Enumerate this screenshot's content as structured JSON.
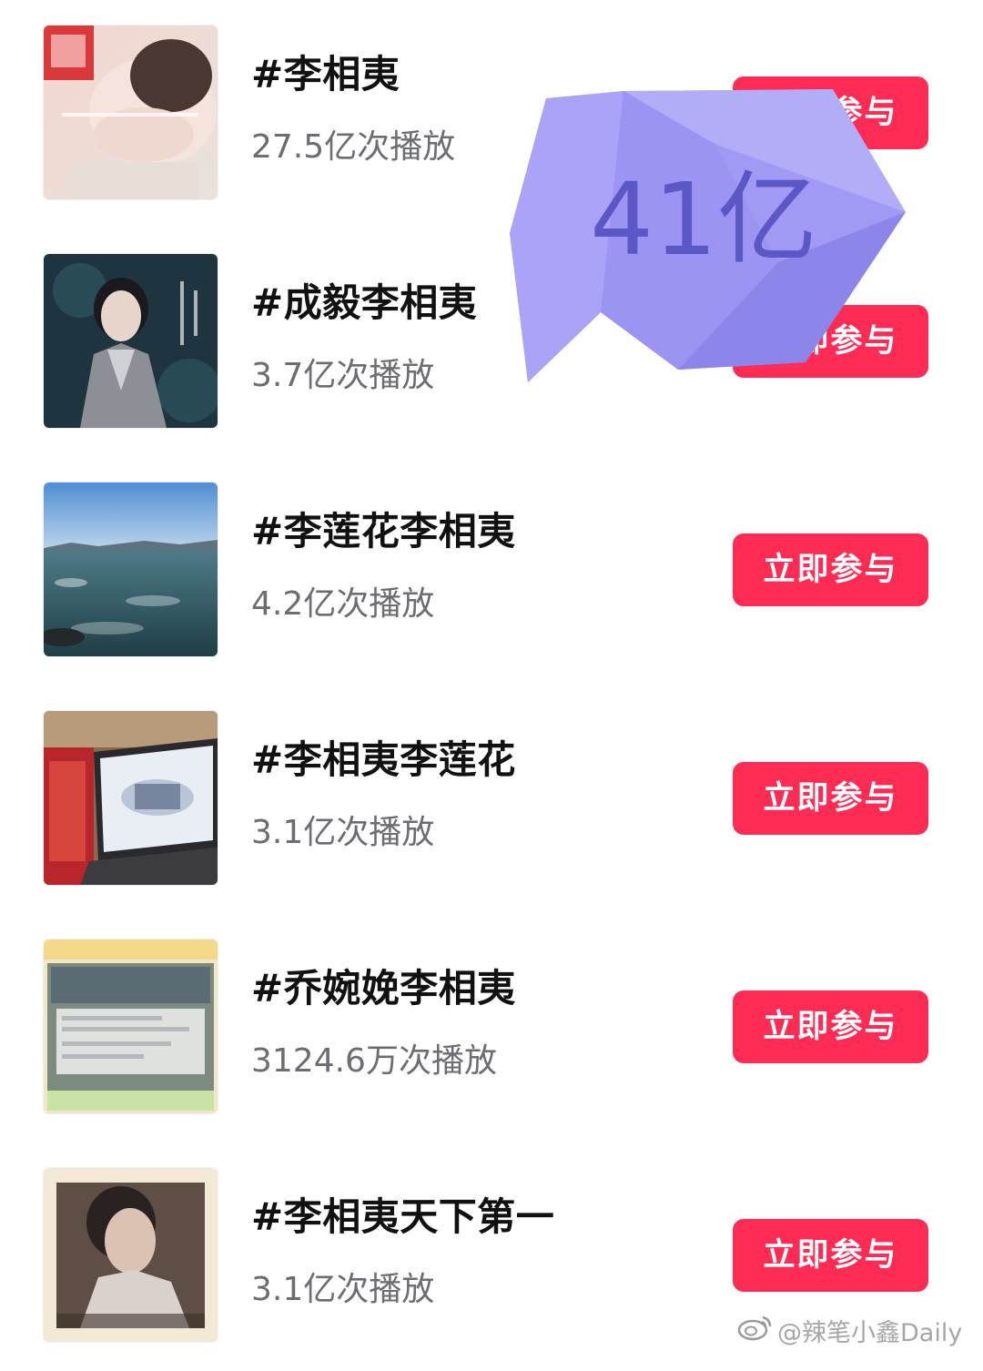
{
  "colors": {
    "button_bg": "#fe2c55",
    "button_text": "#ffffff",
    "title_text": "#111111",
    "plays_text": "#6b6d73",
    "bubble_fill": "#a19af5",
    "bubble_text": "#5b58c6"
  },
  "topics": [
    {
      "title": "#李相夷",
      "plays": "27.5亿次播放",
      "button": "立即参与",
      "thumb": "portrait-light"
    },
    {
      "title": "#成毅李相夷",
      "plays": "3.7亿次播放",
      "button": "立即参与",
      "thumb": "portrait-dark"
    },
    {
      "title": "#李莲花李相夷",
      "plays": "4.2亿次播放",
      "button": "立即参与",
      "thumb": "sea"
    },
    {
      "title": "#李相夷李莲花",
      "plays": "3.1亿次播放",
      "button": "立即参与",
      "thumb": "laptop-poster"
    },
    {
      "title": "#乔婉娩李相夷",
      "plays": "3124.6万次播放",
      "button": "立即参与",
      "thumb": "comment-card"
    },
    {
      "title": "#李相夷天下第一",
      "plays": "3.1亿次播放",
      "button": "立即参与",
      "thumb": "portrait-framed"
    }
  ],
  "overlay": {
    "bubble_text": "41亿"
  },
  "watermark": {
    "text": "@辣笔小鑫Daily",
    "icon": "weibo-icon"
  }
}
